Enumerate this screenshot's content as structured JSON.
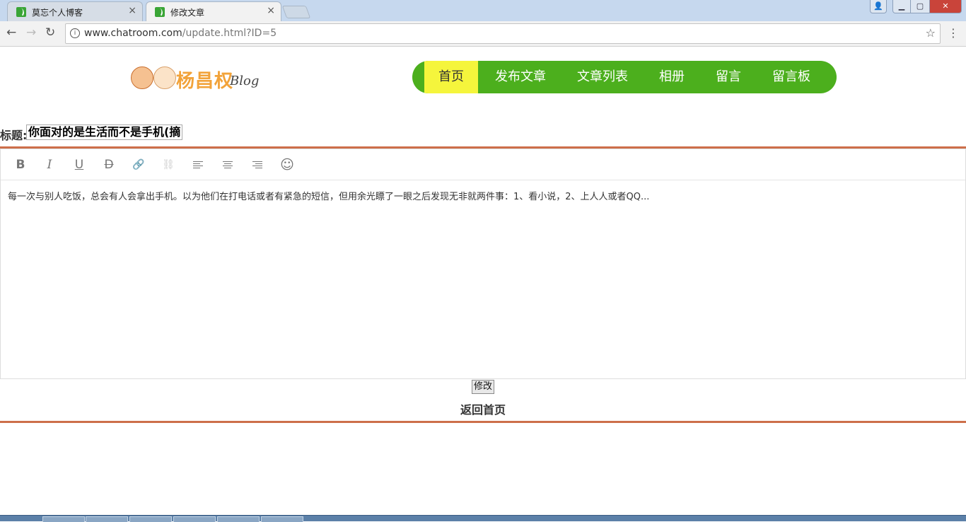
{
  "browser": {
    "tabs": [
      {
        "title": "莫忘个人博客",
        "close": "×",
        "active": false
      },
      {
        "title": "修改文章",
        "close": "×",
        "active": true
      }
    ],
    "url_host": "www.chatroom.com",
    "url_path": "/update.html?ID=5",
    "buttons": {
      "back": "←",
      "forward": "→",
      "reload": "↻",
      "star": "☆",
      "menu": "⋮",
      "info": "i"
    },
    "window_controls": {
      "user": "👤",
      "minimize": "▁",
      "maximize": "▢",
      "close": "✕"
    }
  },
  "site": {
    "logo_text": "杨昌权",
    "logo_sub": "Blog",
    "nav": [
      "首页",
      "发布文章",
      "文章列表",
      "相册",
      "留言",
      "留言板"
    ],
    "nav_active_index": 0
  },
  "form": {
    "title_label": "标题:",
    "title_value": "你面对的是生活而不是手机(摘",
    "editor_content": "每一次与别人吃饭，总会有人会拿出手机。以为他们在打电话或者有紧急的短信，但用余光瞟了一眼之后发现无非就两件事：1、看小说，2、上人人或者QQ...",
    "toolbar": {
      "bold": "B",
      "italic": "I",
      "underline": "U",
      "strike": "D",
      "link": "🔗",
      "unlink": "⛓",
      "emoji": "☺"
    },
    "submit_label": "修改",
    "back_label": "返回首页"
  },
  "colors": {
    "nav_bg": "#4caf1d",
    "nav_active_bg": "#f5f53c",
    "divider": "#cd6f4a"
  }
}
